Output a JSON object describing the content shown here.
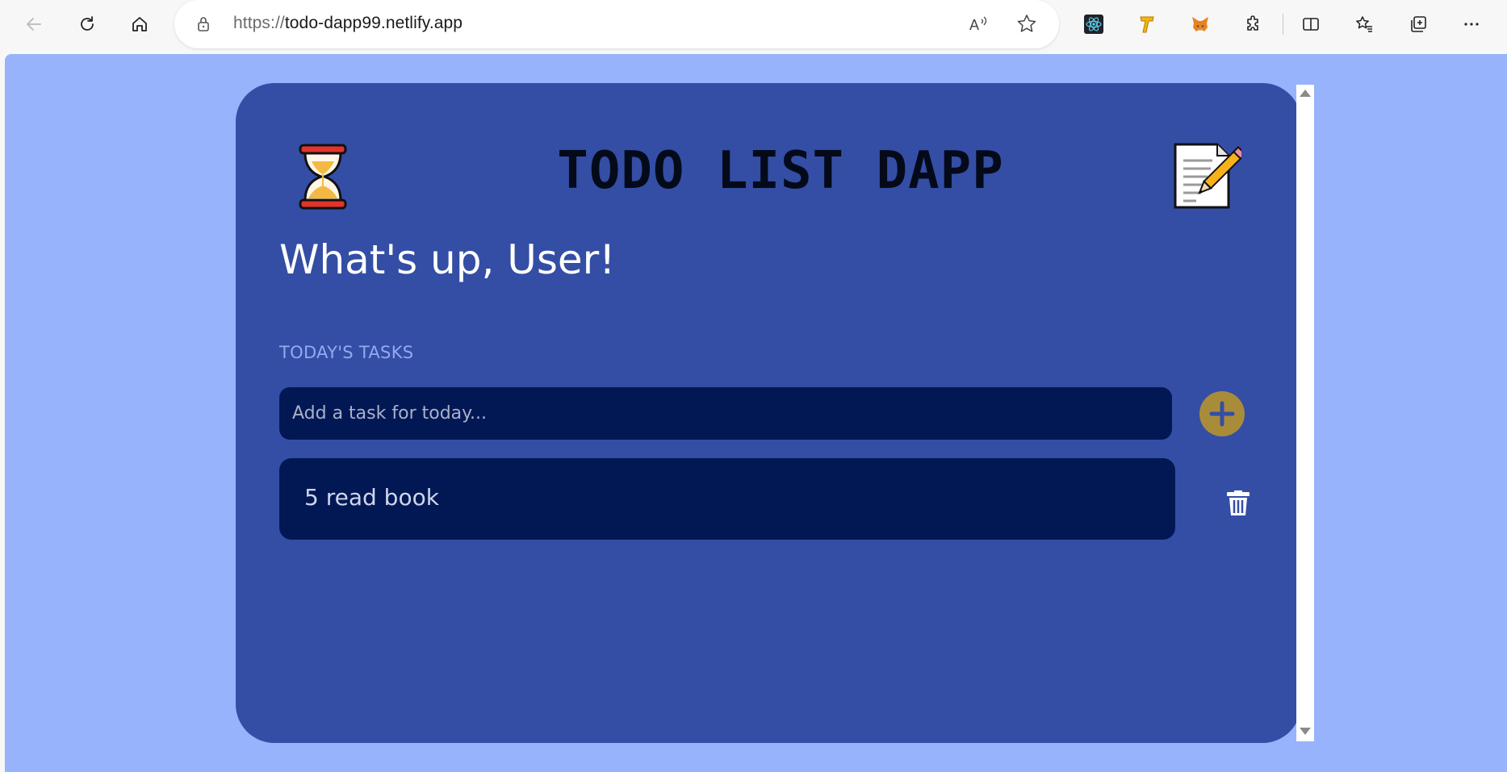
{
  "browser": {
    "url_protocol": "https://",
    "url_host": "todo-dapp99.netlify.app",
    "toolbar_icons": [
      "back-icon",
      "refresh-icon",
      "home-icon",
      "lock-icon",
      "read-aloud-icon",
      "favorite-star-icon",
      "react-devtools-icon",
      "extension-t-icon",
      "metamask-icon",
      "extensions-puzzle-icon",
      "split-screen-icon",
      "favorites-icon",
      "collections-icon",
      "more-icon"
    ]
  },
  "app": {
    "title": "TODO LIST DAPP",
    "greeting": "What's up, User!",
    "section_label": "TODAY'S TASKS",
    "input_placeholder": "Add a task for today...",
    "tasks": [
      {
        "text": "5 read book"
      }
    ]
  },
  "colors": {
    "page_background": "#97b3fb",
    "card_background": "#344ea5",
    "input_background": "#011855",
    "add_button": "#a98c3a",
    "section_label": "#93a9ee"
  }
}
